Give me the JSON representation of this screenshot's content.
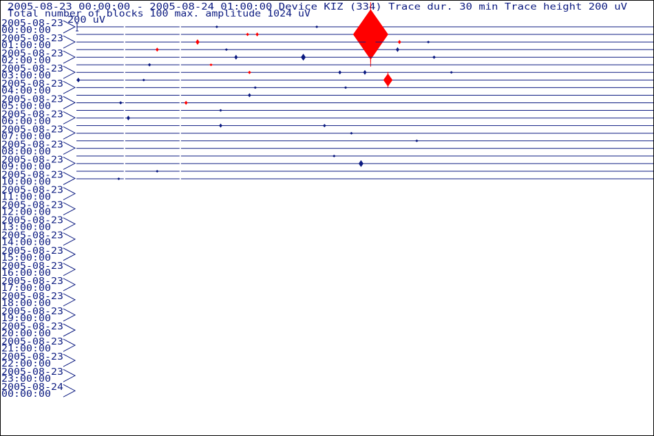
{
  "header": {
    "line1": "2005-08-23 00:00:00 - 2005-08-24 01:00:00  Device  KIZ (334)  Trace dur. 30 min  Trace height 200 uV",
    "line2": "Total number of blocks 100 max. amplitude 1024 uV",
    "scale_label": "200 uV"
  },
  "colors": {
    "trace": "#0b1a80",
    "event": "#ff0000",
    "text": "#0b1a80",
    "frame": "#000000"
  },
  "chart_data": {
    "type": "line",
    "title": "2005-08-23 00:00:00 - 2005-08-24 01:00:00  Device  KIZ (334)  Trace dur. 30 min  Trace height 200 uV",
    "subtitle": "Total number of blocks 100 max. amplitude 1024 uV",
    "trace_duration_min": 30,
    "trace_height_uV": 200,
    "max_amplitude_uV": 1024,
    "total_blocks": 100,
    "hour_labels": [
      {
        "date": "2005-08-23",
        "time": "00:00:00"
      },
      {
        "date": "2005-08-23",
        "time": "01:00:00"
      },
      {
        "date": "2005-08-23",
        "time": "02:00:00"
      },
      {
        "date": "2005-08-23",
        "time": "03:00:00"
      },
      {
        "date": "2005-08-23",
        "time": "04:00:00"
      },
      {
        "date": "2005-08-23",
        "time": "05:00:00"
      },
      {
        "date": "2005-08-23",
        "time": "06:00:00"
      },
      {
        "date": "2005-08-23",
        "time": "07:00:00"
      },
      {
        "date": "2005-08-23",
        "time": "08:00:00"
      },
      {
        "date": "2005-08-23",
        "time": "09:00:00"
      },
      {
        "date": "2005-08-23",
        "time": "10:00:00"
      },
      {
        "date": "2005-08-23",
        "time": "11:00:00"
      },
      {
        "date": "2005-08-23",
        "time": "12:00:00"
      },
      {
        "date": "2005-08-23",
        "time": "13:00:00"
      },
      {
        "date": "2005-08-23",
        "time": "14:00:00"
      },
      {
        "date": "2005-08-23",
        "time": "15:00:00"
      },
      {
        "date": "2005-08-23",
        "time": "16:00:00"
      },
      {
        "date": "2005-08-23",
        "time": "17:00:00"
      },
      {
        "date": "2005-08-23",
        "time": "18:00:00"
      },
      {
        "date": "2005-08-23",
        "time": "19:00:00"
      },
      {
        "date": "2005-08-23",
        "time": "20:00:00"
      },
      {
        "date": "2005-08-23",
        "time": "21:00:00"
      },
      {
        "date": "2005-08-23",
        "time": "22:00:00"
      },
      {
        "date": "2005-08-23",
        "time": "23:00:00"
      },
      {
        "date": "2005-08-24",
        "time": "00:00:00"
      }
    ],
    "traces": [
      {
        "start": "2005-08-23 00:00:00",
        "end": "2005-08-23 00:30:00",
        "events": [
          {
            "t": 7.3,
            "amp": 0.12
          },
          {
            "t": 12.5,
            "amp": 0.08
          }
        ]
      },
      {
        "start": "2005-08-23 00:30:00",
        "end": "2005-08-23 01:00:00",
        "events": [
          {
            "t": 8.9,
            "amp": 0.2,
            "color": "event"
          },
          {
            "t": 9.4,
            "amp": 0.25,
            "color": "event"
          },
          {
            "t": 15.3,
            "amp": 3.6,
            "color": "event"
          }
        ]
      },
      {
        "start": "2005-08-23 01:00:00",
        "end": "2005-08-23 01:30:00",
        "events": [
          {
            "t": 6.3,
            "amp": 0.35,
            "color": "event"
          },
          {
            "t": 15.3,
            "amp": 1.0,
            "color": "event"
          },
          {
            "t": 16.8,
            "amp": 0.25,
            "color": "event"
          },
          {
            "t": 18.3,
            "amp": 0.15
          }
        ]
      },
      {
        "start": "2005-08-23 01:30:00",
        "end": "2005-08-23 02:00:00",
        "events": [
          {
            "t": 4.2,
            "amp": 0.25,
            "color": "event"
          },
          {
            "t": 7.8,
            "amp": 0.1
          },
          {
            "t": 15.3,
            "amp": 1.4,
            "color": "event"
          },
          {
            "t": 16.7,
            "amp": 0.3
          }
        ]
      },
      {
        "start": "2005-08-23 02:00:00",
        "end": "2005-08-23 02:30:00",
        "events": [
          {
            "t": 8.3,
            "amp": 0.3
          },
          {
            "t": 11.8,
            "amp": 0.45
          },
          {
            "t": 18.6,
            "amp": 0.2
          }
        ]
      },
      {
        "start": "2005-08-23 02:30:00",
        "end": "2005-08-23 03:00:00",
        "events": [
          {
            "t": 3.8,
            "amp": 0.2
          },
          {
            "t": 7.0,
            "amp": 0.15,
            "color": "event"
          }
        ]
      },
      {
        "start": "2005-08-23 03:00:00",
        "end": "2005-08-23 03:30:00",
        "events": [
          {
            "t": 9.0,
            "amp": 0.2,
            "color": "event"
          },
          {
            "t": 13.7,
            "amp": 0.25
          },
          {
            "t": 15.0,
            "amp": 0.3
          },
          {
            "t": 19.5,
            "amp": 0.15
          }
        ]
      },
      {
        "start": "2005-08-23 03:30:00",
        "end": "2005-08-23 04:00:00",
        "events": [
          {
            "t": 0.1,
            "amp": 0.3
          },
          {
            "t": 3.5,
            "amp": 0.12
          },
          {
            "t": 16.2,
            "amp": 0.9,
            "color": "event"
          }
        ]
      },
      {
        "start": "2005-08-23 04:00:00",
        "end": "2005-08-23 04:30:00",
        "events": [
          {
            "t": 9.3,
            "amp": 0.15
          },
          {
            "t": 14.0,
            "amp": 0.1
          }
        ]
      },
      {
        "start": "2005-08-23 04:30:00",
        "end": "2005-08-23 05:00:00",
        "events": [
          {
            "t": 9.0,
            "amp": 0.25
          }
        ]
      },
      {
        "start": "2005-08-23 05:00:00",
        "end": "2005-08-23 05:30:00",
        "events": [
          {
            "t": 2.3,
            "amp": 0.2
          },
          {
            "t": 5.7,
            "amp": 0.25,
            "color": "event"
          }
        ]
      },
      {
        "start": "2005-08-23 05:30:00",
        "end": "2005-08-23 06:00:00",
        "events": [
          {
            "t": 7.5,
            "amp": 0.1
          }
        ]
      },
      {
        "start": "2005-08-23 06:00:00",
        "end": "2005-08-23 06:30:00",
        "events": [
          {
            "t": 2.7,
            "amp": 0.3
          }
        ]
      },
      {
        "start": "2005-08-23 06:30:00",
        "end": "2005-08-23 07:00:00",
        "events": [
          {
            "t": 7.5,
            "amp": 0.25
          },
          {
            "t": 12.9,
            "amp": 0.2
          }
        ]
      },
      {
        "start": "2005-08-23 07:00:00",
        "end": "2005-08-23 07:30:00",
        "events": [
          {
            "t": 14.3,
            "amp": 0.12
          }
        ]
      },
      {
        "start": "2005-08-23 07:30:00",
        "end": "2005-08-23 08:00:00",
        "events": [
          {
            "t": 17.7,
            "amp": 0.15
          }
        ]
      },
      {
        "start": "2005-08-23 08:00:00",
        "end": "2005-08-23 08:30:00",
        "events": []
      },
      {
        "start": "2005-08-23 08:30:00",
        "end": "2005-08-23 09:00:00",
        "events": [
          {
            "t": 13.4,
            "amp": 0.08
          }
        ]
      },
      {
        "start": "2005-08-23 09:00:00",
        "end": "2005-08-23 09:30:00",
        "events": [
          {
            "t": 14.8,
            "amp": 0.45
          }
        ]
      },
      {
        "start": "2005-08-23 09:30:00",
        "end": "2005-08-23 10:00:00",
        "events": [
          {
            "t": 4.2,
            "amp": 0.05
          }
        ]
      },
      {
        "start": "2005-08-23 10:00:00",
        "end": "2005-08-23 10:30:00",
        "events": [
          {
            "t": 2.2,
            "amp": 0.1
          }
        ]
      }
    ]
  }
}
